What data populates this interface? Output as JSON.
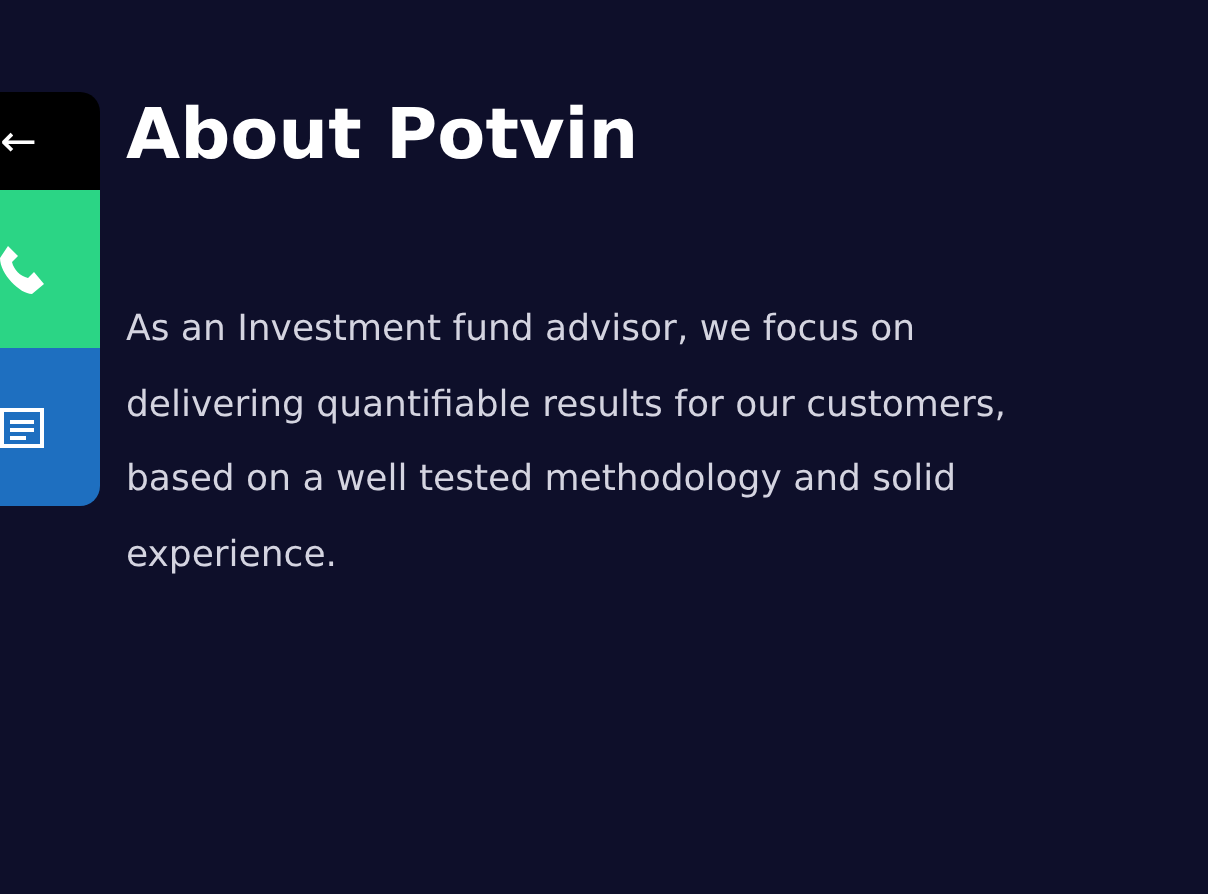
{
  "side_bar": {
    "back": "←"
  },
  "heading": "About Potvin",
  "paragraph": "As an Investment fund advisor, we focus on delivering quantifiable results for our customers, based on a well tested methodology and solid experience."
}
